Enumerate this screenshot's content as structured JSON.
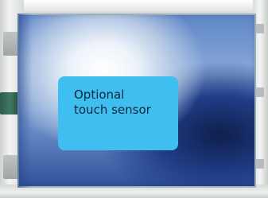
{
  "annotation": {
    "lines": [
      "Optional",
      "touch sensor"
    ]
  },
  "colors": {
    "label_background": "#3fbff0",
    "label_text": "#12243a",
    "panel_blue": "#2f4f98",
    "connector_green": "#3f7a63"
  }
}
